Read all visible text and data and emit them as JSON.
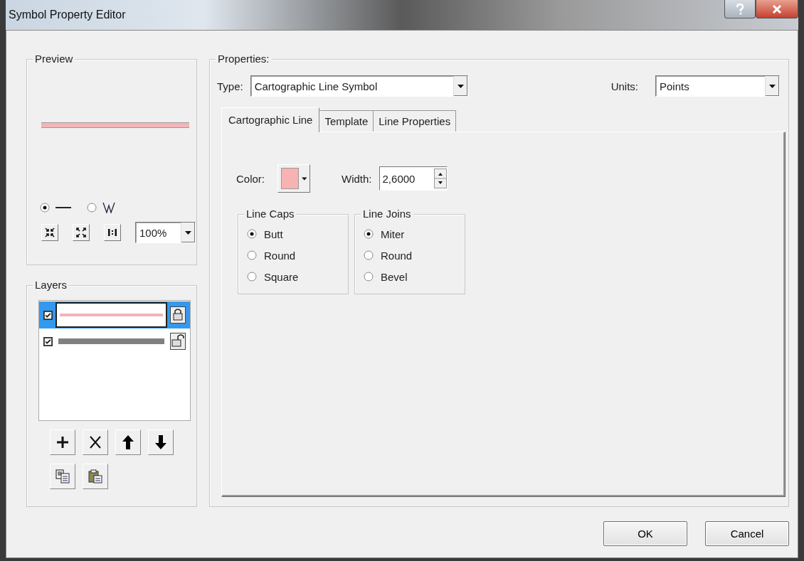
{
  "window": {
    "title": "Symbol Property Editor"
  },
  "preview": {
    "title": "Preview",
    "modes": [
      {
        "kind": "line",
        "selected": true
      },
      {
        "kind": "zigzag",
        "selected": false
      }
    ],
    "zoom": "100%"
  },
  "layers": {
    "title": "Layers",
    "items": [
      {
        "checked": true,
        "selected": true,
        "locked": true,
        "color": "#f4b4b8"
      },
      {
        "checked": true,
        "selected": false,
        "locked": false,
        "color": "#808080"
      }
    ]
  },
  "properties": {
    "title": "Properties:",
    "type_label": "Type:",
    "type_value": "Cartographic Line Symbol",
    "units_label": "Units:",
    "units_value": "Points"
  },
  "tabs": [
    {
      "label": "Cartographic Line",
      "selected": true
    },
    {
      "label": "Template",
      "selected": false
    },
    {
      "label": "Line Properties",
      "selected": false
    }
  ],
  "color_label": "Color:",
  "width_label": "Width:",
  "width_value": "2,6000",
  "line_caps": {
    "title": "Line Caps",
    "options": [
      {
        "label": "Butt",
        "selected": true
      },
      {
        "label": "Round",
        "selected": false
      },
      {
        "label": "Square",
        "selected": false
      }
    ]
  },
  "line_joins": {
    "title": "Line Joins",
    "options": [
      {
        "label": "Miter",
        "selected": true
      },
      {
        "label": "Round",
        "selected": false
      },
      {
        "label": "Bevel",
        "selected": false
      }
    ]
  },
  "buttons": [
    "OK",
    "Cancel"
  ]
}
